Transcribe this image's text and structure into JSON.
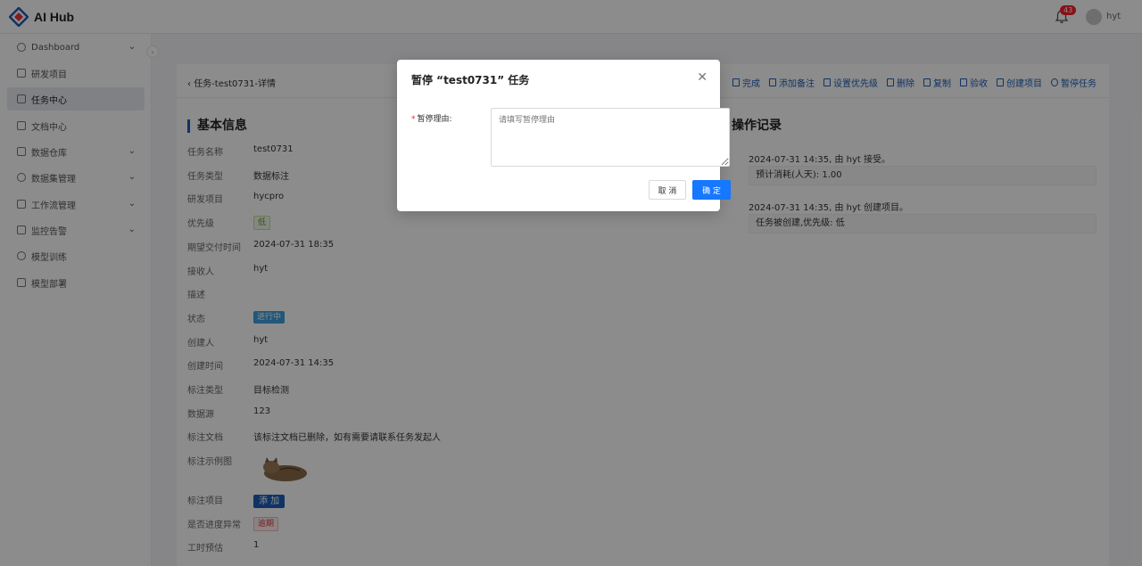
{
  "app": {
    "title": "AI Hub",
    "notification_count": "43",
    "username": "hyt"
  },
  "sidebar": {
    "items": [
      {
        "label": "Dashboard",
        "icon": "dashboard-icon",
        "expandable": true,
        "active": false
      },
      {
        "label": "研发项目",
        "icon": "folder-icon",
        "expandable": false,
        "active": false
      },
      {
        "label": "任务中心",
        "icon": "task-icon",
        "expandable": false,
        "active": true
      },
      {
        "label": "文档中心",
        "icon": "document-icon",
        "expandable": false,
        "active": false
      },
      {
        "label": "数据仓库",
        "icon": "warehouse-icon",
        "expandable": true,
        "active": false
      },
      {
        "label": "数据集管理",
        "icon": "database-icon",
        "expandable": true,
        "active": false
      },
      {
        "label": "工作流管理",
        "icon": "workflow-icon",
        "expandable": true,
        "active": false
      },
      {
        "label": "监控告警",
        "icon": "warning-icon",
        "expandable": true,
        "active": false
      },
      {
        "label": "模型训练",
        "icon": "train-icon",
        "expandable": false,
        "active": false
      },
      {
        "label": "模型部署",
        "icon": "deploy-icon",
        "expandable": false,
        "active": false
      }
    ]
  },
  "page": {
    "back_title": "任务-test0731-详情",
    "actions": [
      "完成",
      "添加备注",
      "设置优先级",
      "删除",
      "复制",
      "验收",
      "创建项目",
      "暂停任务"
    ],
    "basic_info_title": "基本信息",
    "fields": [
      {
        "key": "任务名称",
        "value": "test0731"
      },
      {
        "key": "任务类型",
        "value": "数据标注"
      },
      {
        "key": "研发项目",
        "value": "hycpro"
      },
      {
        "key": "优先级",
        "value": "低"
      },
      {
        "key": "期望交付时间",
        "value": "2024-07-31 18:35"
      },
      {
        "key": "接收人",
        "value": "hyt"
      },
      {
        "key": "描述",
        "value": ""
      },
      {
        "key": "状态",
        "value": "进行中"
      },
      {
        "key": "创建人",
        "value": "hyt"
      },
      {
        "key": "创建时间",
        "value": "2024-07-31 14:35"
      },
      {
        "key": "标注类型",
        "value": "目标检测"
      },
      {
        "key": "数据源",
        "value": "123"
      },
      {
        "key": "标注文档",
        "value": "该标注文档已删除，如有需要请联系任务发起人"
      },
      {
        "key": "标注示例图",
        "value": ""
      },
      {
        "key": "标注项目",
        "value": "添 加"
      },
      {
        "key": "是否进度异常",
        "value": "逾期"
      },
      {
        "key": "工时预估",
        "value": "1"
      }
    ],
    "log_title": "操作记录",
    "logs": [
      {
        "date": "2024-07-31 14:35, 由 hyt 接受。",
        "detail": "预计消耗(人天): 1.00"
      },
      {
        "date": "2024-07-31 14:35, 由 hyt 创建项目。",
        "detail": "任务被创建,优先级: 低"
      }
    ]
  },
  "modal": {
    "title": "暂停 “test0731” 任务",
    "field_label": "暂停理由:",
    "placeholder": "请填写暂停理由",
    "cancel_label": "取 消",
    "ok_label": "确 定"
  },
  "colors": {
    "primary": "#1677ff",
    "accent": "#1e5eb8",
    "danger": "#f5222d"
  }
}
